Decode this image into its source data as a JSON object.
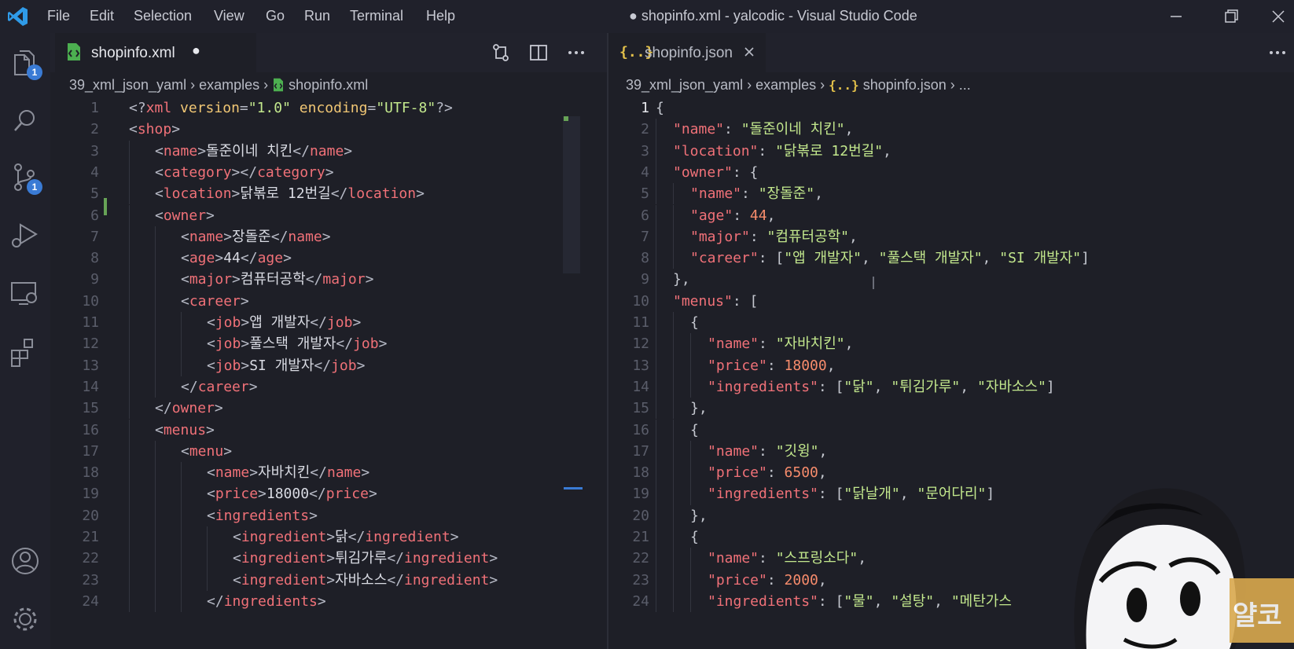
{
  "titlebar": {
    "menus": [
      "File",
      "Edit",
      "Selection",
      "View",
      "Go",
      "Run",
      "Terminal",
      "Help"
    ],
    "title": "● shopinfo.xml - yalcodic - Visual Studio Code"
  },
  "activity": {
    "explorer_badge": "1",
    "scm_badge": "1"
  },
  "left_editor": {
    "tab_label": "shopinfo.xml",
    "tab_dirty": "●",
    "breadcrumb": [
      "39_xml_json_yaml",
      "examples",
      "shopinfo.xml"
    ],
    "lines": [
      {
        "n": "1",
        "indent": 0,
        "tokens": [
          [
            "t-br",
            "<?"
          ],
          [
            "t-tag",
            "xml"
          ],
          [
            "t-br",
            " "
          ],
          [
            "t-attr",
            "version"
          ],
          [
            "t-br",
            "="
          ],
          [
            "t-str",
            "\"1.0\""
          ],
          [
            "t-br",
            " "
          ],
          [
            "t-attr",
            "encoding"
          ],
          [
            "t-br",
            "="
          ],
          [
            "t-str",
            "\"UTF-8\""
          ],
          [
            "t-br",
            "?>"
          ]
        ]
      },
      {
        "n": "2",
        "indent": 0,
        "tokens": [
          [
            "t-br",
            "<"
          ],
          [
            "t-tag",
            "shop"
          ],
          [
            "t-br",
            ">"
          ]
        ]
      },
      {
        "n": "3",
        "indent": 1,
        "tokens": [
          [
            "t-br",
            "<"
          ],
          [
            "t-tag",
            "name"
          ],
          [
            "t-br",
            ">"
          ],
          [
            "t-text",
            "돌준이네 치킨"
          ],
          [
            "t-br",
            "</"
          ],
          [
            "t-tag",
            "name"
          ],
          [
            "t-br",
            ">"
          ]
        ]
      },
      {
        "n": "4",
        "indent": 1,
        "tokens": [
          [
            "t-br",
            "<"
          ],
          [
            "t-tag",
            "category"
          ],
          [
            "t-br",
            "></"
          ],
          [
            "t-tag",
            "category"
          ],
          [
            "t-br",
            ">"
          ]
        ]
      },
      {
        "n": "5",
        "indent": 1,
        "tokens": [
          [
            "t-br",
            "<"
          ],
          [
            "t-tag",
            "location"
          ],
          [
            "t-br",
            ">"
          ],
          [
            "t-text",
            "닭볶로 12번길"
          ],
          [
            "t-br",
            "</"
          ],
          [
            "t-tag",
            "location"
          ],
          [
            "t-br",
            ">"
          ]
        ]
      },
      {
        "n": "6",
        "indent": 1,
        "tokens": [
          [
            "t-br",
            "<"
          ],
          [
            "t-tag",
            "owner"
          ],
          [
            "t-br",
            ">"
          ]
        ]
      },
      {
        "n": "7",
        "indent": 2,
        "tokens": [
          [
            "t-br",
            "<"
          ],
          [
            "t-tag",
            "name"
          ],
          [
            "t-br",
            ">"
          ],
          [
            "t-text",
            "장돌준"
          ],
          [
            "t-br",
            "</"
          ],
          [
            "t-tag",
            "name"
          ],
          [
            "t-br",
            ">"
          ]
        ]
      },
      {
        "n": "8",
        "indent": 2,
        "tokens": [
          [
            "t-br",
            "<"
          ],
          [
            "t-tag",
            "age"
          ],
          [
            "t-br",
            ">"
          ],
          [
            "t-text",
            "44"
          ],
          [
            "t-br",
            "</"
          ],
          [
            "t-tag",
            "age"
          ],
          [
            "t-br",
            ">"
          ]
        ]
      },
      {
        "n": "9",
        "indent": 2,
        "tokens": [
          [
            "t-br",
            "<"
          ],
          [
            "t-tag",
            "major"
          ],
          [
            "t-br",
            ">"
          ],
          [
            "t-text",
            "컴퓨터공학"
          ],
          [
            "t-br",
            "</"
          ],
          [
            "t-tag",
            "major"
          ],
          [
            "t-br",
            ">"
          ]
        ]
      },
      {
        "n": "10",
        "indent": 2,
        "tokens": [
          [
            "t-br",
            "<"
          ],
          [
            "t-tag",
            "career"
          ],
          [
            "t-br",
            ">"
          ]
        ]
      },
      {
        "n": "11",
        "indent": 3,
        "tokens": [
          [
            "t-br",
            "<"
          ],
          [
            "t-tag",
            "job"
          ],
          [
            "t-br",
            ">"
          ],
          [
            "t-text",
            "앱 개발자"
          ],
          [
            "t-br",
            "</"
          ],
          [
            "t-tag",
            "job"
          ],
          [
            "t-br",
            ">"
          ]
        ]
      },
      {
        "n": "12",
        "indent": 3,
        "tokens": [
          [
            "t-br",
            "<"
          ],
          [
            "t-tag",
            "job"
          ],
          [
            "t-br",
            ">"
          ],
          [
            "t-text",
            "풀스택 개발자"
          ],
          [
            "t-br",
            "</"
          ],
          [
            "t-tag",
            "job"
          ],
          [
            "t-br",
            ">"
          ]
        ]
      },
      {
        "n": "13",
        "indent": 3,
        "tokens": [
          [
            "t-br",
            "<"
          ],
          [
            "t-tag",
            "job"
          ],
          [
            "t-br",
            ">"
          ],
          [
            "t-text",
            "SI 개발자"
          ],
          [
            "t-br",
            "</"
          ],
          [
            "t-tag",
            "job"
          ],
          [
            "t-br",
            ">"
          ]
        ]
      },
      {
        "n": "14",
        "indent": 2,
        "tokens": [
          [
            "t-br",
            "</"
          ],
          [
            "t-tag",
            "career"
          ],
          [
            "t-br",
            ">"
          ]
        ]
      },
      {
        "n": "15",
        "indent": 1,
        "tokens": [
          [
            "t-br",
            "</"
          ],
          [
            "t-tag",
            "owner"
          ],
          [
            "t-br",
            ">"
          ]
        ]
      },
      {
        "n": "16",
        "indent": 1,
        "tokens": [
          [
            "t-br",
            "<"
          ],
          [
            "t-tag",
            "menus"
          ],
          [
            "t-br",
            ">"
          ]
        ]
      },
      {
        "n": "17",
        "indent": 2,
        "tokens": [
          [
            "t-br",
            "<"
          ],
          [
            "t-tag",
            "menu"
          ],
          [
            "t-br",
            ">"
          ]
        ]
      },
      {
        "n": "18",
        "indent": 3,
        "tokens": [
          [
            "t-br",
            "<"
          ],
          [
            "t-tag",
            "name"
          ],
          [
            "t-br",
            ">"
          ],
          [
            "t-text",
            "자바치킨"
          ],
          [
            "t-br",
            "</"
          ],
          [
            "t-tag",
            "name"
          ],
          [
            "t-br",
            ">"
          ]
        ]
      },
      {
        "n": "19",
        "indent": 3,
        "tokens": [
          [
            "t-br",
            "<"
          ],
          [
            "t-tag",
            "price"
          ],
          [
            "t-br",
            ">"
          ],
          [
            "t-text",
            "18000"
          ],
          [
            "t-br",
            "</"
          ],
          [
            "t-tag",
            "price"
          ],
          [
            "t-br",
            ">"
          ]
        ]
      },
      {
        "n": "20",
        "indent": 3,
        "tokens": [
          [
            "t-br",
            "<"
          ],
          [
            "t-tag",
            "ingredients"
          ],
          [
            "t-br",
            ">"
          ]
        ]
      },
      {
        "n": "21",
        "indent": 4,
        "tokens": [
          [
            "t-br",
            "<"
          ],
          [
            "t-tag",
            "ingredient"
          ],
          [
            "t-br",
            ">"
          ],
          [
            "t-text",
            "닭"
          ],
          [
            "t-br",
            "</"
          ],
          [
            "t-tag",
            "ingredient"
          ],
          [
            "t-br",
            ">"
          ]
        ]
      },
      {
        "n": "22",
        "indent": 4,
        "tokens": [
          [
            "t-br",
            "<"
          ],
          [
            "t-tag",
            "ingredient"
          ],
          [
            "t-br",
            ">"
          ],
          [
            "t-text",
            "튀김가루"
          ],
          [
            "t-br",
            "</"
          ],
          [
            "t-tag",
            "ingredient"
          ],
          [
            "t-br",
            ">"
          ]
        ]
      },
      {
        "n": "23",
        "indent": 4,
        "tokens": [
          [
            "t-br",
            "<"
          ],
          [
            "t-tag",
            "ingredient"
          ],
          [
            "t-br",
            ">"
          ],
          [
            "t-text",
            "자바소스"
          ],
          [
            "t-br",
            "</"
          ],
          [
            "t-tag",
            "ingredient"
          ],
          [
            "t-br",
            ">"
          ]
        ]
      },
      {
        "n": "24",
        "indent": 3,
        "tokens": [
          [
            "t-br",
            "</"
          ],
          [
            "t-tag",
            "ingredients"
          ],
          [
            "t-br",
            ">"
          ]
        ]
      }
    ]
  },
  "right_editor": {
    "tab_label": "shopinfo.json",
    "tab_icon_text": "{..}",
    "breadcrumb": [
      "39_xml_json_yaml",
      "examples",
      "shopinfo.json",
      "..."
    ],
    "lines": [
      {
        "n": "1",
        "indent": 0,
        "tokens": [
          [
            "t-punc",
            "{"
          ]
        ]
      },
      {
        "n": "2",
        "indent": 1,
        "tokens": [
          [
            "t-key",
            "\"name\""
          ],
          [
            "t-punc",
            ": "
          ],
          [
            "t-str",
            "\"돌준이네 치킨\""
          ],
          [
            "t-punc",
            ","
          ]
        ]
      },
      {
        "n": "3",
        "indent": 1,
        "tokens": [
          [
            "t-key",
            "\"location\""
          ],
          [
            "t-punc",
            ": "
          ],
          [
            "t-str",
            "\"닭볶로 12번길\""
          ],
          [
            "t-punc",
            ","
          ]
        ]
      },
      {
        "n": "4",
        "indent": 1,
        "tokens": [
          [
            "t-key",
            "\"owner\""
          ],
          [
            "t-punc",
            ": {"
          ]
        ]
      },
      {
        "n": "5",
        "indent": 2,
        "tokens": [
          [
            "t-key",
            "\"name\""
          ],
          [
            "t-punc",
            ": "
          ],
          [
            "t-str",
            "\"장돌준\""
          ],
          [
            "t-punc",
            ","
          ]
        ]
      },
      {
        "n": "6",
        "indent": 2,
        "tokens": [
          [
            "t-key",
            "\"age\""
          ],
          [
            "t-punc",
            ": "
          ],
          [
            "t-num",
            "44"
          ],
          [
            "t-punc",
            ","
          ]
        ]
      },
      {
        "n": "7",
        "indent": 2,
        "tokens": [
          [
            "t-key",
            "\"major\""
          ],
          [
            "t-punc",
            ": "
          ],
          [
            "t-str",
            "\"컴퓨터공학\""
          ],
          [
            "t-punc",
            ","
          ]
        ]
      },
      {
        "n": "8",
        "indent": 2,
        "tokens": [
          [
            "t-key",
            "\"career\""
          ],
          [
            "t-punc",
            ": ["
          ],
          [
            "t-str",
            "\"앱 개발자\""
          ],
          [
            "t-punc",
            ", "
          ],
          [
            "t-str",
            "\"풀스택 개발자\""
          ],
          [
            "t-punc",
            ", "
          ],
          [
            "t-str",
            "\"SI 개발자\""
          ],
          [
            "t-punc",
            "]"
          ]
        ]
      },
      {
        "n": "9",
        "indent": 1,
        "tokens": [
          [
            "t-punc",
            "},"
          ]
        ]
      },
      {
        "n": "10",
        "indent": 1,
        "tokens": [
          [
            "t-key",
            "\"menus\""
          ],
          [
            "t-punc",
            ": ["
          ]
        ]
      },
      {
        "n": "11",
        "indent": 2,
        "tokens": [
          [
            "t-punc",
            "{"
          ]
        ]
      },
      {
        "n": "12",
        "indent": 3,
        "tokens": [
          [
            "t-key",
            "\"name\""
          ],
          [
            "t-punc",
            ": "
          ],
          [
            "t-str",
            "\"자바치킨\""
          ],
          [
            "t-punc",
            ","
          ]
        ]
      },
      {
        "n": "13",
        "indent": 3,
        "tokens": [
          [
            "t-key",
            "\"price\""
          ],
          [
            "t-punc",
            ": "
          ],
          [
            "t-num",
            "18000"
          ],
          [
            "t-punc",
            ","
          ]
        ]
      },
      {
        "n": "14",
        "indent": 3,
        "tokens": [
          [
            "t-key",
            "\"ingredients\""
          ],
          [
            "t-punc",
            ": ["
          ],
          [
            "t-str",
            "\"닭\""
          ],
          [
            "t-punc",
            ", "
          ],
          [
            "t-str",
            "\"튀김가루\""
          ],
          [
            "t-punc",
            ", "
          ],
          [
            "t-str",
            "\"자바소스\""
          ],
          [
            "t-punc",
            "]"
          ]
        ]
      },
      {
        "n": "15",
        "indent": 2,
        "tokens": [
          [
            "t-punc",
            "},"
          ]
        ]
      },
      {
        "n": "16",
        "indent": 2,
        "tokens": [
          [
            "t-punc",
            "{"
          ]
        ]
      },
      {
        "n": "17",
        "indent": 3,
        "tokens": [
          [
            "t-key",
            "\"name\""
          ],
          [
            "t-punc",
            ": "
          ],
          [
            "t-str",
            "\"깃윙\""
          ],
          [
            "t-punc",
            ","
          ]
        ]
      },
      {
        "n": "18",
        "indent": 3,
        "tokens": [
          [
            "t-key",
            "\"price\""
          ],
          [
            "t-punc",
            ": "
          ],
          [
            "t-num",
            "6500"
          ],
          [
            "t-punc",
            ","
          ]
        ]
      },
      {
        "n": "19",
        "indent": 3,
        "tokens": [
          [
            "t-key",
            "\"ingredients\""
          ],
          [
            "t-punc",
            ": ["
          ],
          [
            "t-str",
            "\"닭날개\""
          ],
          [
            "t-punc",
            ", "
          ],
          [
            "t-str",
            "\"문어다리\""
          ],
          [
            "t-punc",
            "]"
          ]
        ]
      },
      {
        "n": "20",
        "indent": 2,
        "tokens": [
          [
            "t-punc",
            "},"
          ]
        ]
      },
      {
        "n": "21",
        "indent": 2,
        "tokens": [
          [
            "t-punc",
            "{"
          ]
        ]
      },
      {
        "n": "22",
        "indent": 3,
        "tokens": [
          [
            "t-key",
            "\"name\""
          ],
          [
            "t-punc",
            ": "
          ],
          [
            "t-str",
            "\"스프링소다\""
          ],
          [
            "t-punc",
            ","
          ]
        ]
      },
      {
        "n": "23",
        "indent": 3,
        "tokens": [
          [
            "t-key",
            "\"price\""
          ],
          [
            "t-punc",
            ": "
          ],
          [
            "t-num",
            "2000"
          ],
          [
            "t-punc",
            ","
          ]
        ]
      },
      {
        "n": "24",
        "indent": 3,
        "tokens": [
          [
            "t-key",
            "\"ingredients\""
          ],
          [
            "t-punc",
            ": ["
          ],
          [
            "t-str",
            "\"물\""
          ],
          [
            "t-punc",
            ", "
          ],
          [
            "t-str",
            "\"설탕\""
          ],
          [
            "t-punc",
            ", "
          ],
          [
            "t-str",
            "\"메탄가스"
          ]
        ]
      }
    ]
  },
  "watermark": {
    "label": "얄코"
  },
  "colors": {
    "accent_blue": "#3a7bd5",
    "tag_red": "#f07178",
    "string_green": "#c3e88d",
    "number_orange": "#f78c6c"
  }
}
